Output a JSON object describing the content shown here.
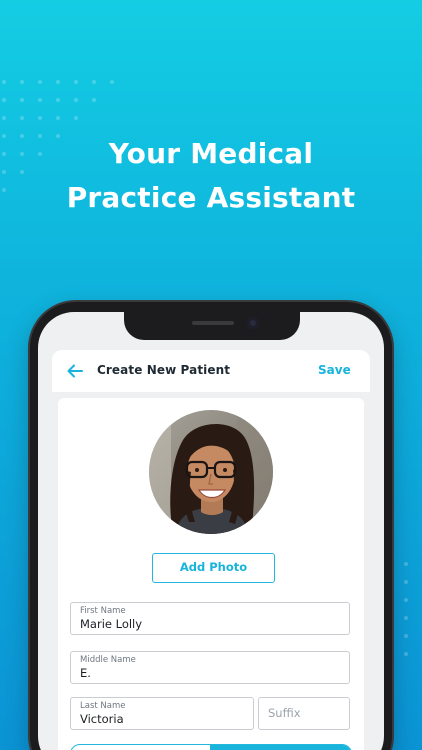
{
  "promo": {
    "headline_line1": "Your Medical",
    "headline_line2": "Practice Assistant"
  },
  "app_bar": {
    "title": "Create New Patient",
    "save_label": "Save",
    "back_icon": "arrow-left-icon"
  },
  "photo": {
    "add_photo_label": "Add Photo"
  },
  "form": {
    "first_name": {
      "label": "First Name",
      "value": "Marie Lolly"
    },
    "middle_name": {
      "label": "Middle Name",
      "value": "E."
    },
    "last_name": {
      "label": "Last Name",
      "value": "Victoria"
    },
    "suffix": {
      "placeholder": "Suffix"
    }
  },
  "colors": {
    "accent": "#18b4dc",
    "background_top": "#14cde3",
    "background_bottom": "#0b93d4"
  }
}
